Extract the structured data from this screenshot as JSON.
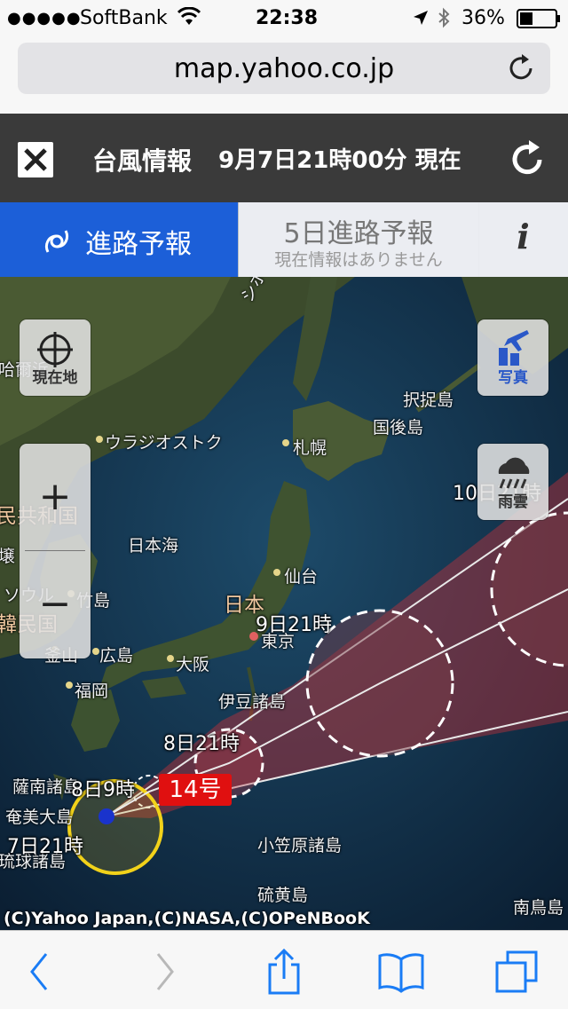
{
  "status_bar": {
    "signal": "●●●●●",
    "carrier": "SoftBank",
    "time": "22:38",
    "battery_percent": "36%",
    "battery_level": 0.36
  },
  "browser": {
    "url": "map.yahoo.co.jp"
  },
  "header": {
    "title": "台風情報",
    "timestamp": "9月7日21時00分 現在"
  },
  "tabs": {
    "route": "進路予報",
    "five_day": "5日進路予報",
    "five_day_sub": "現在情報はありません",
    "info": "i"
  },
  "map": {
    "controls": {
      "locate": "現在地",
      "photo": "写真",
      "rain": "雨雲",
      "zoom_in": "+",
      "zoom_out": "−"
    },
    "place_labels": {
      "mountains": "シホテ・アリニ山脈",
      "hakodate_partial": "哈爾浜",
      "vladivostok": "ウラジオストク",
      "prc_partial": "民共和国",
      "sea_of_japan": "日本海",
      "sapporo": "札幌",
      "etorofu": "択捉島",
      "kunashiri": "国後島",
      "sendai": "仙台",
      "japan": "日本",
      "tokyo": "東京",
      "izu": "伊豆諸島",
      "osaka": "大阪",
      "hiroshima": "広島",
      "fukuoka": "福岡",
      "takeshima": "竹島",
      "seoul": "ソウル",
      "busan": "釜山",
      "korea_partial": "韓民国",
      "pyongyang_partial": "壌",
      "satsunan": "薩南諸島",
      "amami": "奄美大島",
      "ryukyu": "琉球諸島",
      "ogasawara": "小笠原諸島",
      "iwo": "硫黄島",
      "minamitori": "南鳥島"
    },
    "forecast_labels": {
      "t0": "7日21時",
      "t1": "8日9時",
      "t2": "8日21時",
      "t3": "9日21時",
      "t4": "10日21時"
    },
    "typhoon_name": "14号",
    "copyright": "(C)Yahoo Japan,(C)NASA,(C)OPeNBooK",
    "colors": {
      "forecast_cone": "#c0303a",
      "storm_circle": "#f2d21a",
      "badge": "#e01010",
      "center": "#1a33cc"
    }
  },
  "toolbar": {
    "icons": [
      "back-icon",
      "forward-icon",
      "share-icon",
      "bookmarks-icon",
      "tabs-icon"
    ]
  },
  "accent": "#1c5fd8"
}
